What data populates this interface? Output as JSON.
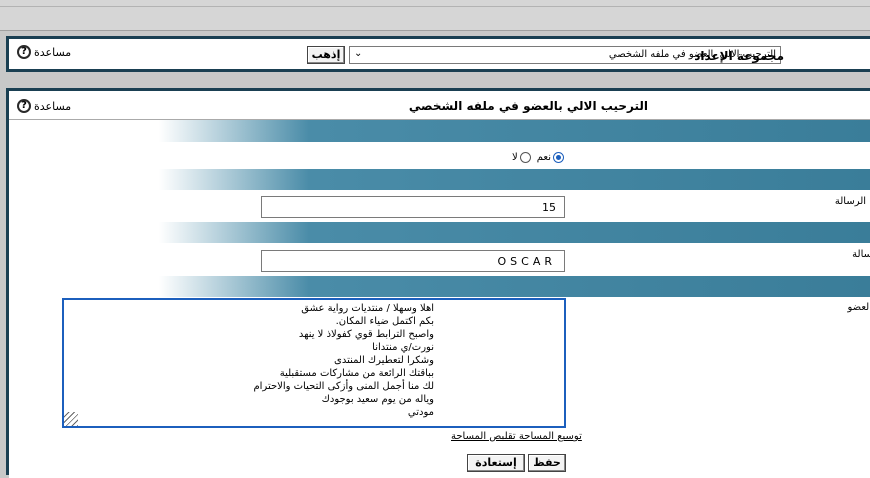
{
  "settings_group": {
    "label": "مجموعة الإعداد",
    "selected": "الترحيب الالي بالعضو في ملفه الشخصي",
    "go_label": "إذهب",
    "help_label": "مساعدة"
  },
  "main_panel": {
    "title": "الترحيب الالي بالعضو في ملفه الشخصي",
    "help_label": "مساعدة"
  },
  "enable": {
    "yes_label": "نعم",
    "no_label": "لا",
    "selected": "yes"
  },
  "fields": {
    "field1_label": "ا الرسالة",
    "field1_value": "15",
    "field2_label": "سالة",
    "field2_value": "OSCAR",
    "field3_label": "العضو"
  },
  "message_text": "اهلا وسهلا / منتديات رواية عشق\nبكم اكتمل ضياء المكان.\nواصبح الترابط قوي كفولاذ لا ينهد\nنورت/ي منتدانا\nوشكرا لتعطيرك المنتدى\nبباقتك الرائعة من مشاركات مستقبلية\nلك منا أجمل المنى وأزكى التحيات والاحترام\nوياله من يوم سعيد بوجودك\nمودتي",
  "textarea_links": "توسيع المساحة تقليص المساحة",
  "buttons": {
    "save_label": "حفظ",
    "reset_label": "إستعادة"
  }
}
